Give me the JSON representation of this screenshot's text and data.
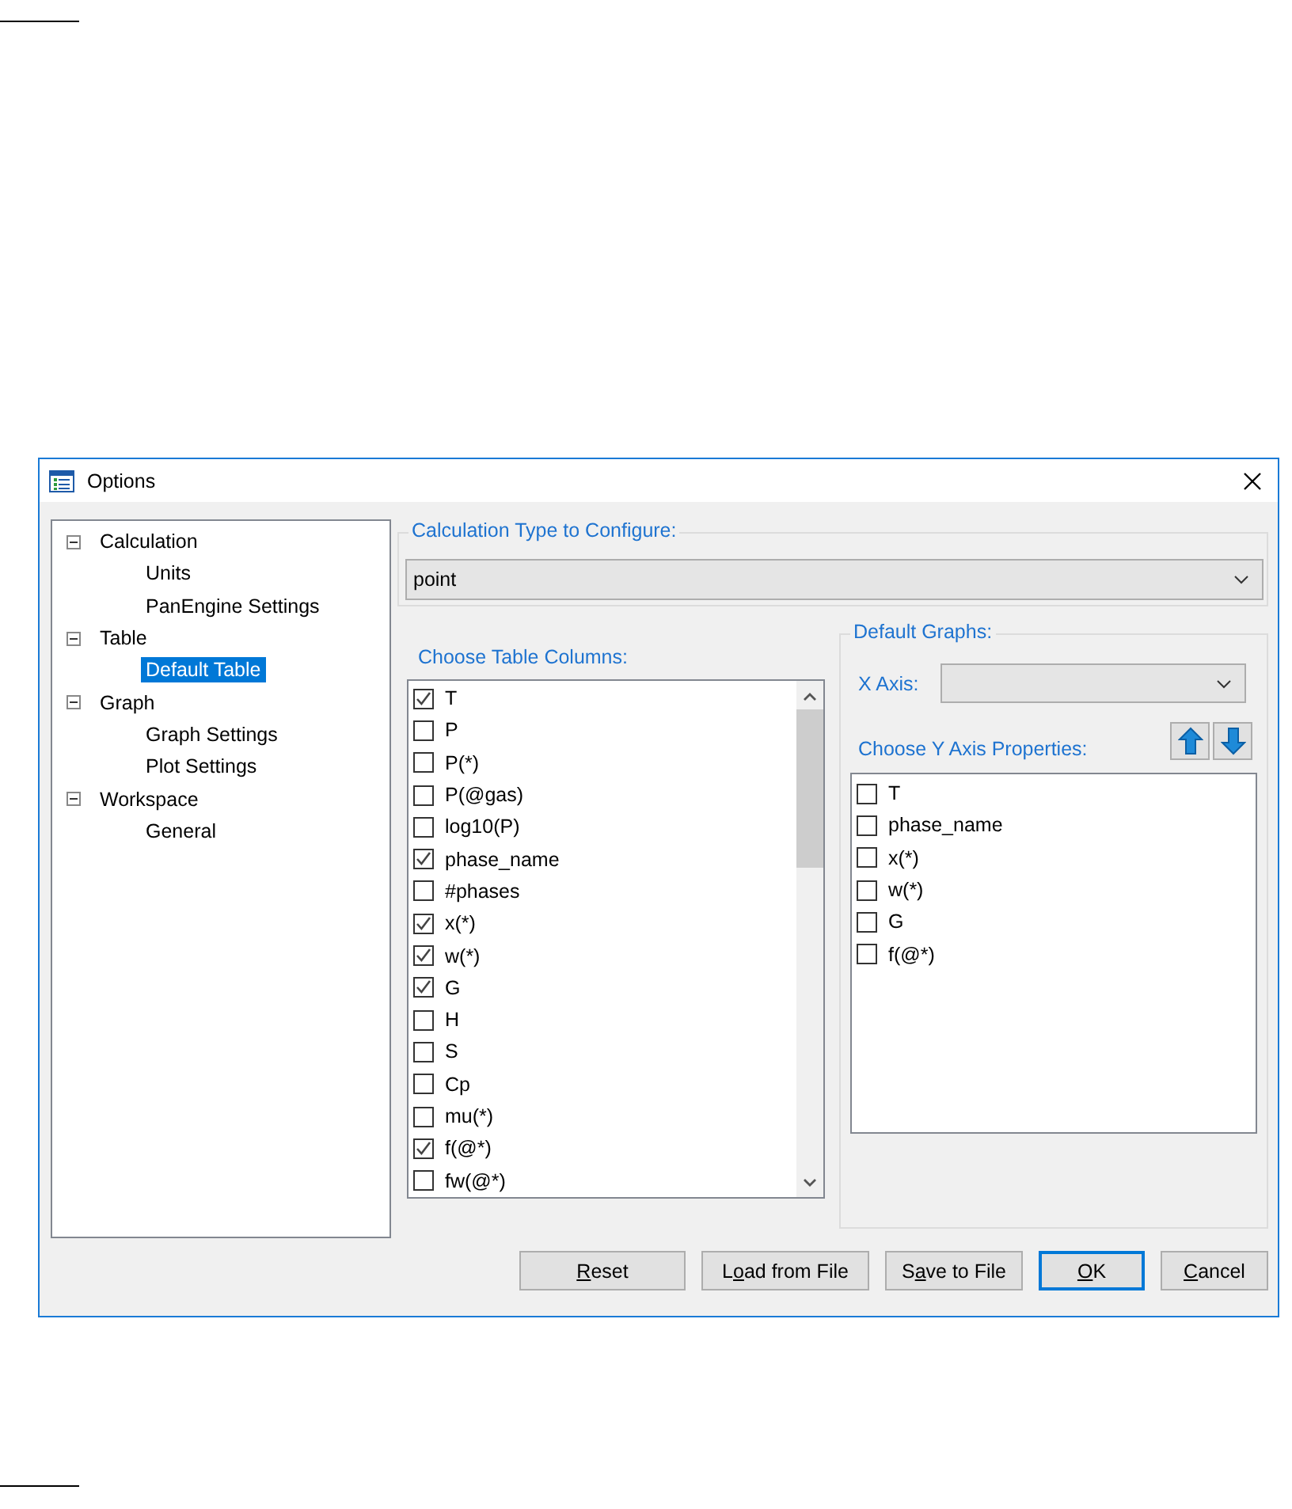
{
  "window": {
    "title": "Options"
  },
  "tree": [
    {
      "label": "Calculation",
      "expanded": true,
      "selected": false,
      "children": [
        {
          "label": "Units",
          "selected": false
        },
        {
          "label": "PanEngine Settings",
          "selected": false
        }
      ]
    },
    {
      "label": "Table",
      "expanded": true,
      "selected": false,
      "children": [
        {
          "label": "Default Table",
          "selected": true
        }
      ]
    },
    {
      "label": "Graph",
      "expanded": true,
      "selected": false,
      "children": [
        {
          "label": "Graph Settings",
          "selected": false
        },
        {
          "label": "Plot Settings",
          "selected": false
        }
      ]
    },
    {
      "label": "Workspace",
      "expanded": true,
      "selected": false,
      "children": [
        {
          "label": "General",
          "selected": false
        }
      ]
    }
  ],
  "calc_type": {
    "group_label": "Calculation Type to Configure:",
    "value": "point"
  },
  "table_columns": {
    "label": "Choose Table Columns:",
    "items": [
      {
        "label": "T",
        "checked": true
      },
      {
        "label": "P",
        "checked": false
      },
      {
        "label": "P(*)",
        "checked": false
      },
      {
        "label": "P(@gas)",
        "checked": false
      },
      {
        "label": "log10(P)",
        "checked": false
      },
      {
        "label": "phase_name",
        "checked": true
      },
      {
        "label": "#phases",
        "checked": false
      },
      {
        "label": "x(*)",
        "checked": true
      },
      {
        "label": "w(*)",
        "checked": true
      },
      {
        "label": "G",
        "checked": true
      },
      {
        "label": "H",
        "checked": false
      },
      {
        "label": "S",
        "checked": false
      },
      {
        "label": "Cp",
        "checked": false
      },
      {
        "label": "mu(*)",
        "checked": false
      },
      {
        "label": "f(@*)",
        "checked": true
      },
      {
        "label": "fw(@*)",
        "checked": false
      }
    ]
  },
  "default_graphs": {
    "group_label": "Default Graphs:",
    "x_axis_label": "X Axis:",
    "y_label": "Choose Y Axis Properties:",
    "y_items": [
      {
        "label": "T",
        "checked": false
      },
      {
        "label": "phase_name",
        "checked": false
      },
      {
        "label": "x(*)",
        "checked": false
      },
      {
        "label": "w(*)",
        "checked": false
      },
      {
        "label": "G",
        "checked": false
      },
      {
        "label": "f(@*)",
        "checked": false
      }
    ]
  },
  "buttons": [
    {
      "key": "R",
      "after": "eset",
      "default": false
    },
    {
      "before": "L",
      "key": "o",
      "after": "ad from File",
      "default": false
    },
    {
      "before": "S",
      "key": "a",
      "after": "ve to File",
      "default": false
    },
    {
      "key": "O",
      "after": "K",
      "default": true
    },
    {
      "key": "C",
      "after": "ancel",
      "default": false
    }
  ]
}
